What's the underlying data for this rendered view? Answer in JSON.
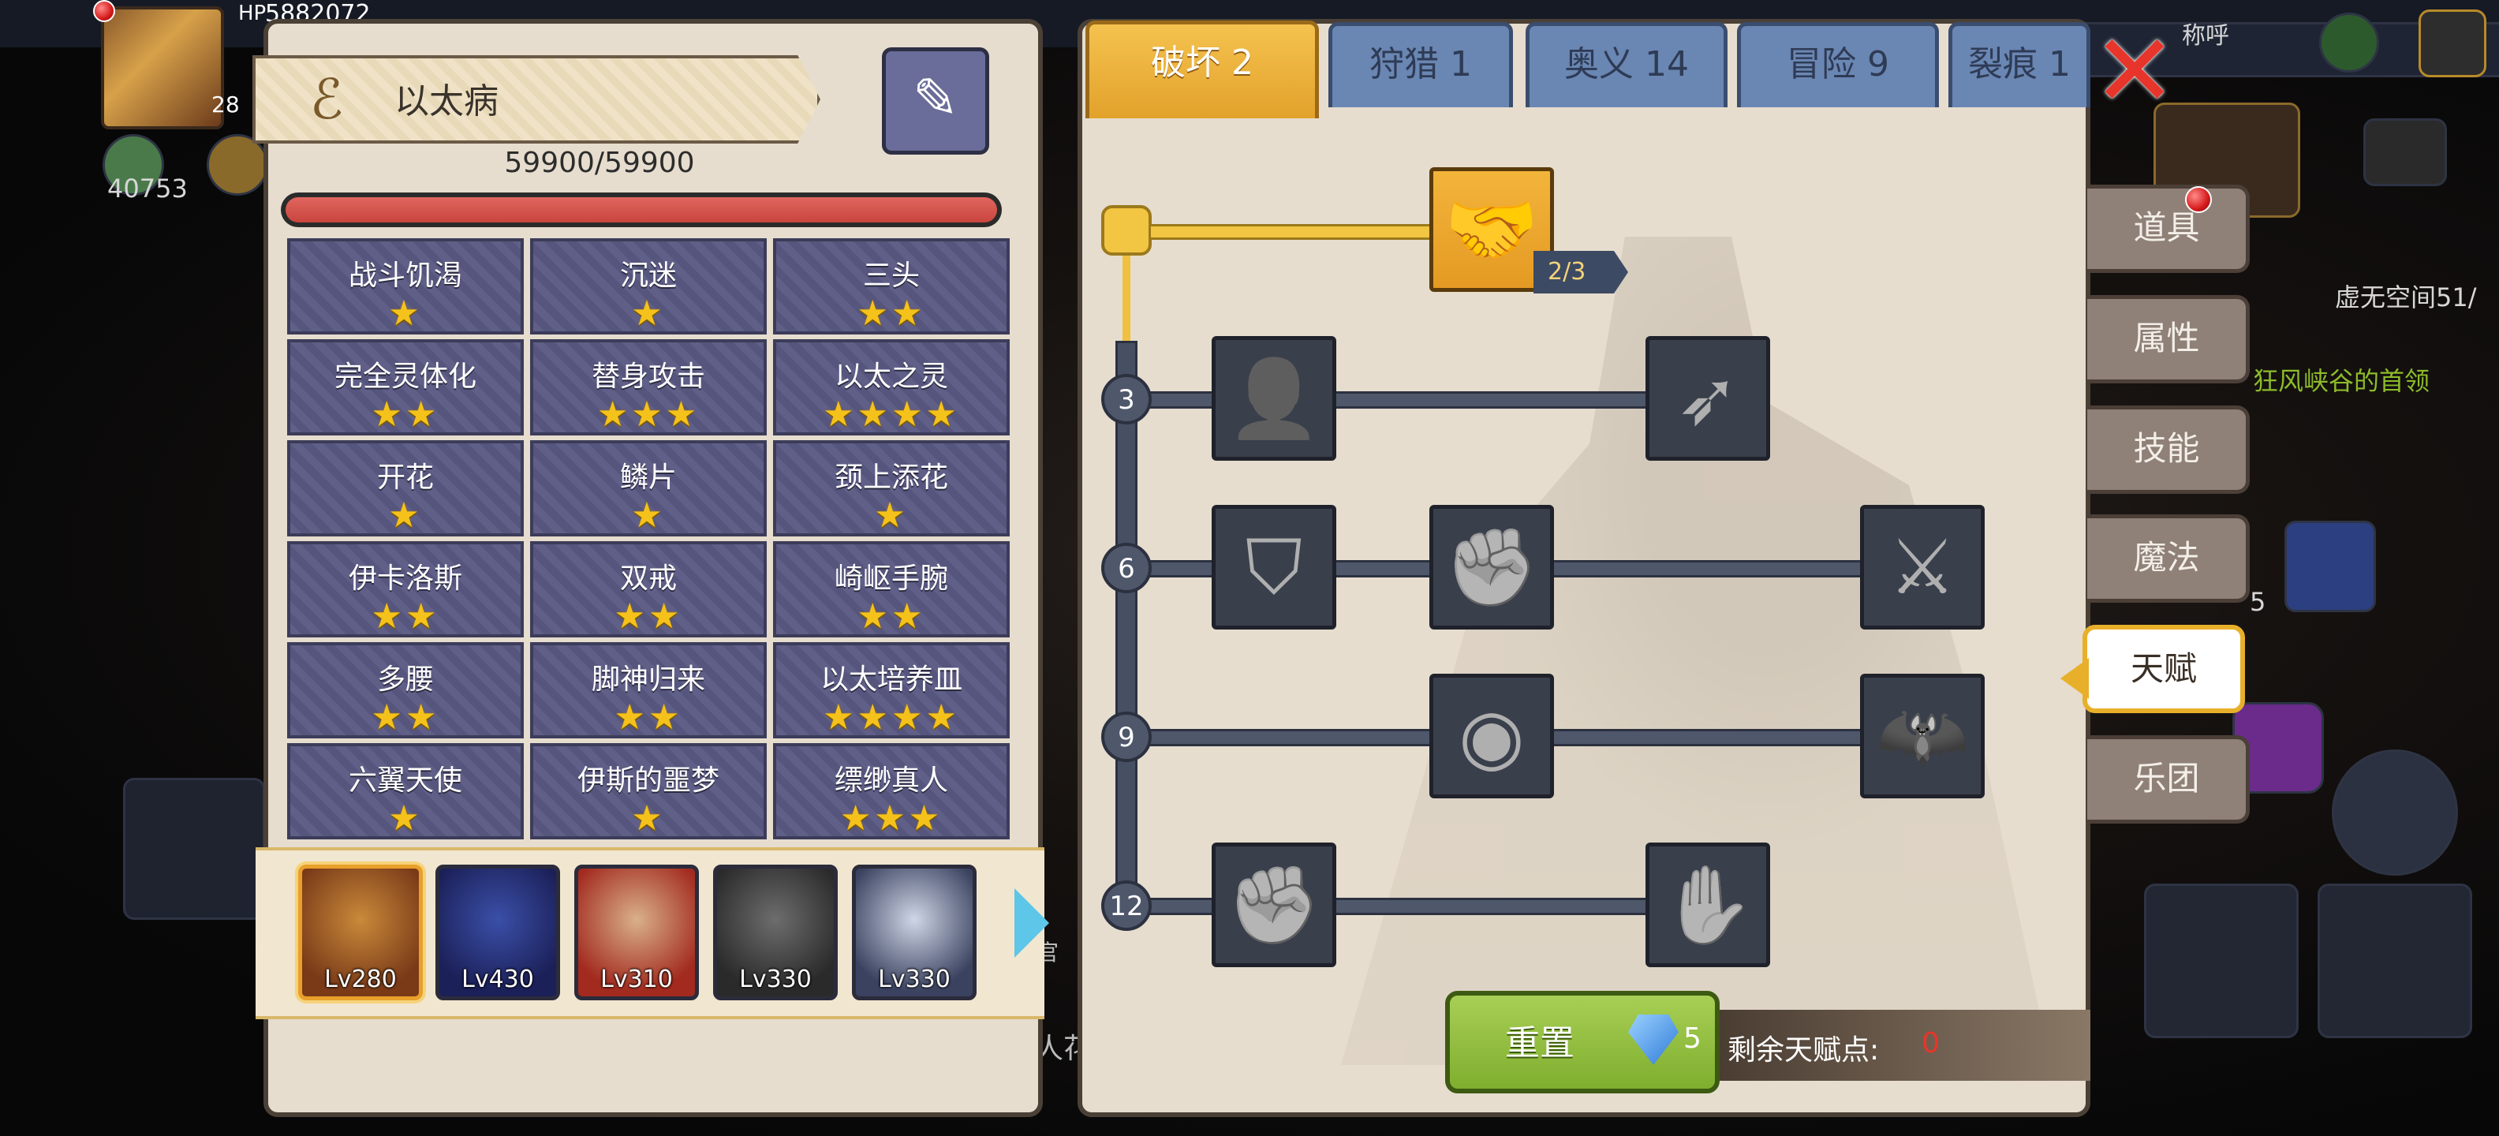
{
  "background": {
    "top_hp_label": "HP",
    "top_hp_value": "5882072",
    "top_level": "28",
    "resource_value": "40753",
    "side_text_1": "虚无空间51/",
    "side_text_2": "狂风峡谷的首领",
    "side_num": "5",
    "partial_name": "称呼",
    "partial_text": "人花",
    "partial_small": "官"
  },
  "left_panel": {
    "title": "以太病",
    "hp_text": "59900/59900",
    "hp_fill_fraction": 1.0,
    "traits": [
      {
        "label": "战斗饥渴",
        "stars": 1
      },
      {
        "label": "沉迷",
        "stars": 1
      },
      {
        "label": "三头",
        "stars": 2
      },
      {
        "label": "完全灵体化",
        "stars": 2
      },
      {
        "label": "替身攻击",
        "stars": 3
      },
      {
        "label": "以太之灵",
        "stars": 4
      },
      {
        "label": "开花",
        "stars": 1
      },
      {
        "label": "鳞片",
        "stars": 1
      },
      {
        "label": "颈上添花",
        "stars": 1
      },
      {
        "label": "伊卡洛斯",
        "stars": 2
      },
      {
        "label": "双戒",
        "stars": 2
      },
      {
        "label": "崎岖手腕",
        "stars": 2
      },
      {
        "label": "多腰",
        "stars": 2
      },
      {
        "label": "脚神归来",
        "stars": 2
      },
      {
        "label": "以太培养皿",
        "stars": 4
      },
      {
        "label": "六翼天使",
        "stars": 1
      },
      {
        "label": "伊斯的噩梦",
        "stars": 1
      },
      {
        "label": "缥缈真人",
        "stars": 3
      }
    ],
    "heroes": [
      {
        "level": "Lv280",
        "color1": "#c98a3a",
        "color2": "#7a3a18",
        "selected": true
      },
      {
        "level": "Lv430",
        "color1": "#3b4fa8",
        "color2": "#1b2058",
        "selected": false
      },
      {
        "level": "Lv310",
        "color1": "#d9b08a",
        "color2": "#a22a1e",
        "selected": false
      },
      {
        "level": "Lv330",
        "color1": "#6d6d6d",
        "color2": "#2a2a2a",
        "selected": false
      },
      {
        "level": "Lv330",
        "color1": "#cfd6e6",
        "color2": "#3a4260",
        "selected": false
      }
    ]
  },
  "tabs": [
    {
      "label": "破坏 2",
      "active": true
    },
    {
      "label": "狩猎 1",
      "active": false
    },
    {
      "label": "奥义 14",
      "active": false
    },
    {
      "label": "冒险 9",
      "active": false
    },
    {
      "label": "裂痕 1",
      "active": false
    }
  ],
  "talent_tree": {
    "start_badge": "2/3",
    "levels": [
      "3",
      "6",
      "9",
      "12"
    ],
    "talents": [
      {
        "icon": "handshake-icon",
        "glyph": "🤝",
        "active": true
      },
      {
        "icon": "body-icon",
        "glyph": "👤",
        "active": false
      },
      {
        "icon": "arrow-icon",
        "glyph": "➶",
        "active": false
      },
      {
        "icon": "shield-crack-icon",
        "glyph": "⛉",
        "active": false
      },
      {
        "icon": "punch-icon",
        "glyph": "✊",
        "active": false
      },
      {
        "icon": "sword-splash-icon",
        "glyph": "⚔",
        "active": false
      },
      {
        "icon": "orb-ripple-icon",
        "glyph": "◉",
        "active": false
      },
      {
        "icon": "bat-icon",
        "glyph": "🦇",
        "active": false
      },
      {
        "icon": "fist-icon",
        "glyph": "✊",
        "active": false
      },
      {
        "icon": "fist-stripe-icon",
        "glyph": "✋",
        "active": false
      }
    ]
  },
  "reset": {
    "label": "重置",
    "cost": "5"
  },
  "remaining": {
    "label": "剩余天赋点:",
    "value": "0"
  },
  "side_menu": [
    {
      "label": "道具",
      "active": false,
      "dot": true
    },
    {
      "label": "属性",
      "active": false
    },
    {
      "label": "技能",
      "active": false
    },
    {
      "label": "魔法",
      "active": false
    },
    {
      "label": "天赋",
      "active": true
    },
    {
      "label": "乐团",
      "active": false
    }
  ],
  "colors": {
    "accent_gold": "#e8b02a",
    "hp_red": "#c9453e",
    "close_red": "#e8352b"
  }
}
